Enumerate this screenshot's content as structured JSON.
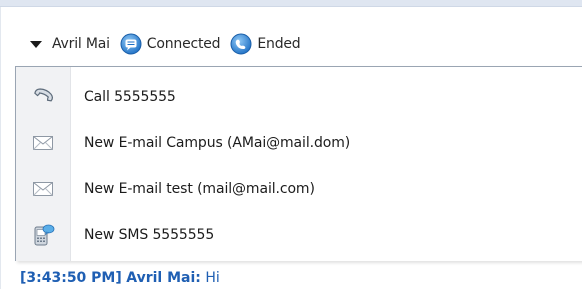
{
  "toolbar": {
    "contact_name": "Avril Mai",
    "connected_label": "Connected",
    "ended_label": "Ended"
  },
  "menu": {
    "items": [
      {
        "label": "Call 5555555",
        "icon": "phone-icon"
      },
      {
        "label": "New E-mail Campus (AMai@mail.dom)",
        "icon": "envelope-icon"
      },
      {
        "label": "New E-mail test (mail@mail.com)",
        "icon": "envelope-icon"
      },
      {
        "label": "New SMS 5555555",
        "icon": "sms-icon"
      }
    ]
  },
  "chat": {
    "timestamp": "[3:43:50 PM]",
    "sender": "Avril Mai:",
    "message": "Hi"
  },
  "colors": {
    "accent": "#1f5fb3",
    "menu_border": "#9aa5b3",
    "gutter": "#f1f2f4"
  }
}
